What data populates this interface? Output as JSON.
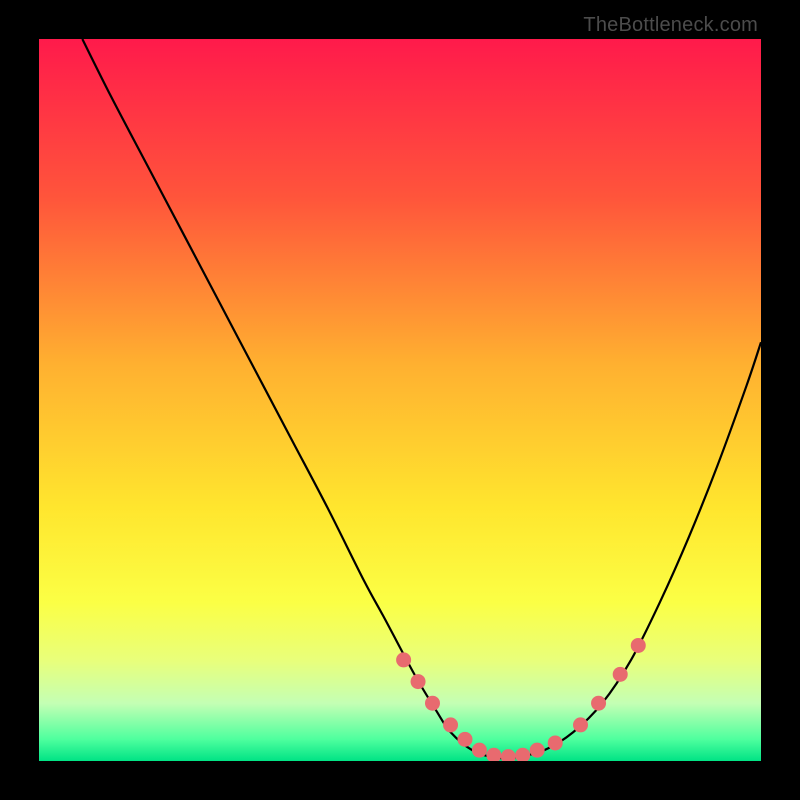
{
  "watermark": "TheBottleneck.com",
  "chart_data": {
    "type": "line",
    "title": "",
    "xlabel": "",
    "ylabel": "",
    "xlim": [
      0,
      100
    ],
    "ylim": [
      0,
      100
    ],
    "gradient_stops": [
      {
        "offset": 0,
        "color": "#ff1a4b"
      },
      {
        "offset": 22,
        "color": "#ff553b"
      },
      {
        "offset": 45,
        "color": "#ffb030"
      },
      {
        "offset": 65,
        "color": "#ffe62e"
      },
      {
        "offset": 78,
        "color": "#fbff45"
      },
      {
        "offset": 86,
        "color": "#e9ff7a"
      },
      {
        "offset": 92,
        "color": "#c4ffb4"
      },
      {
        "offset": 97,
        "color": "#4eff9e"
      },
      {
        "offset": 100,
        "color": "#00e385"
      }
    ],
    "series": [
      {
        "name": "bottleneck-curve",
        "x": [
          6,
          10,
          15,
          20,
          25,
          30,
          35,
          40,
          45,
          48,
          52,
          55,
          57,
          60,
          63,
          66,
          70,
          74,
          78,
          82,
          86,
          90,
          94,
          98,
          100
        ],
        "y": [
          100,
          92,
          82.5,
          73,
          63.5,
          54,
          44.5,
          35,
          25,
          19.5,
          12,
          7,
          4,
          1.5,
          0.5,
          0.5,
          1.5,
          4,
          8,
          14,
          22,
          31,
          41,
          52,
          58
        ]
      }
    ],
    "marker_points": {
      "x": [
        50.5,
        52.5,
        54.5,
        57,
        59,
        61,
        63,
        65,
        67,
        69,
        71.5,
        75,
        77.5,
        80.5,
        83
      ],
      "y": [
        14,
        11,
        8,
        5,
        3,
        1.5,
        0.8,
        0.6,
        0.8,
        1.5,
        2.5,
        5,
        8,
        12,
        16
      ]
    }
  }
}
